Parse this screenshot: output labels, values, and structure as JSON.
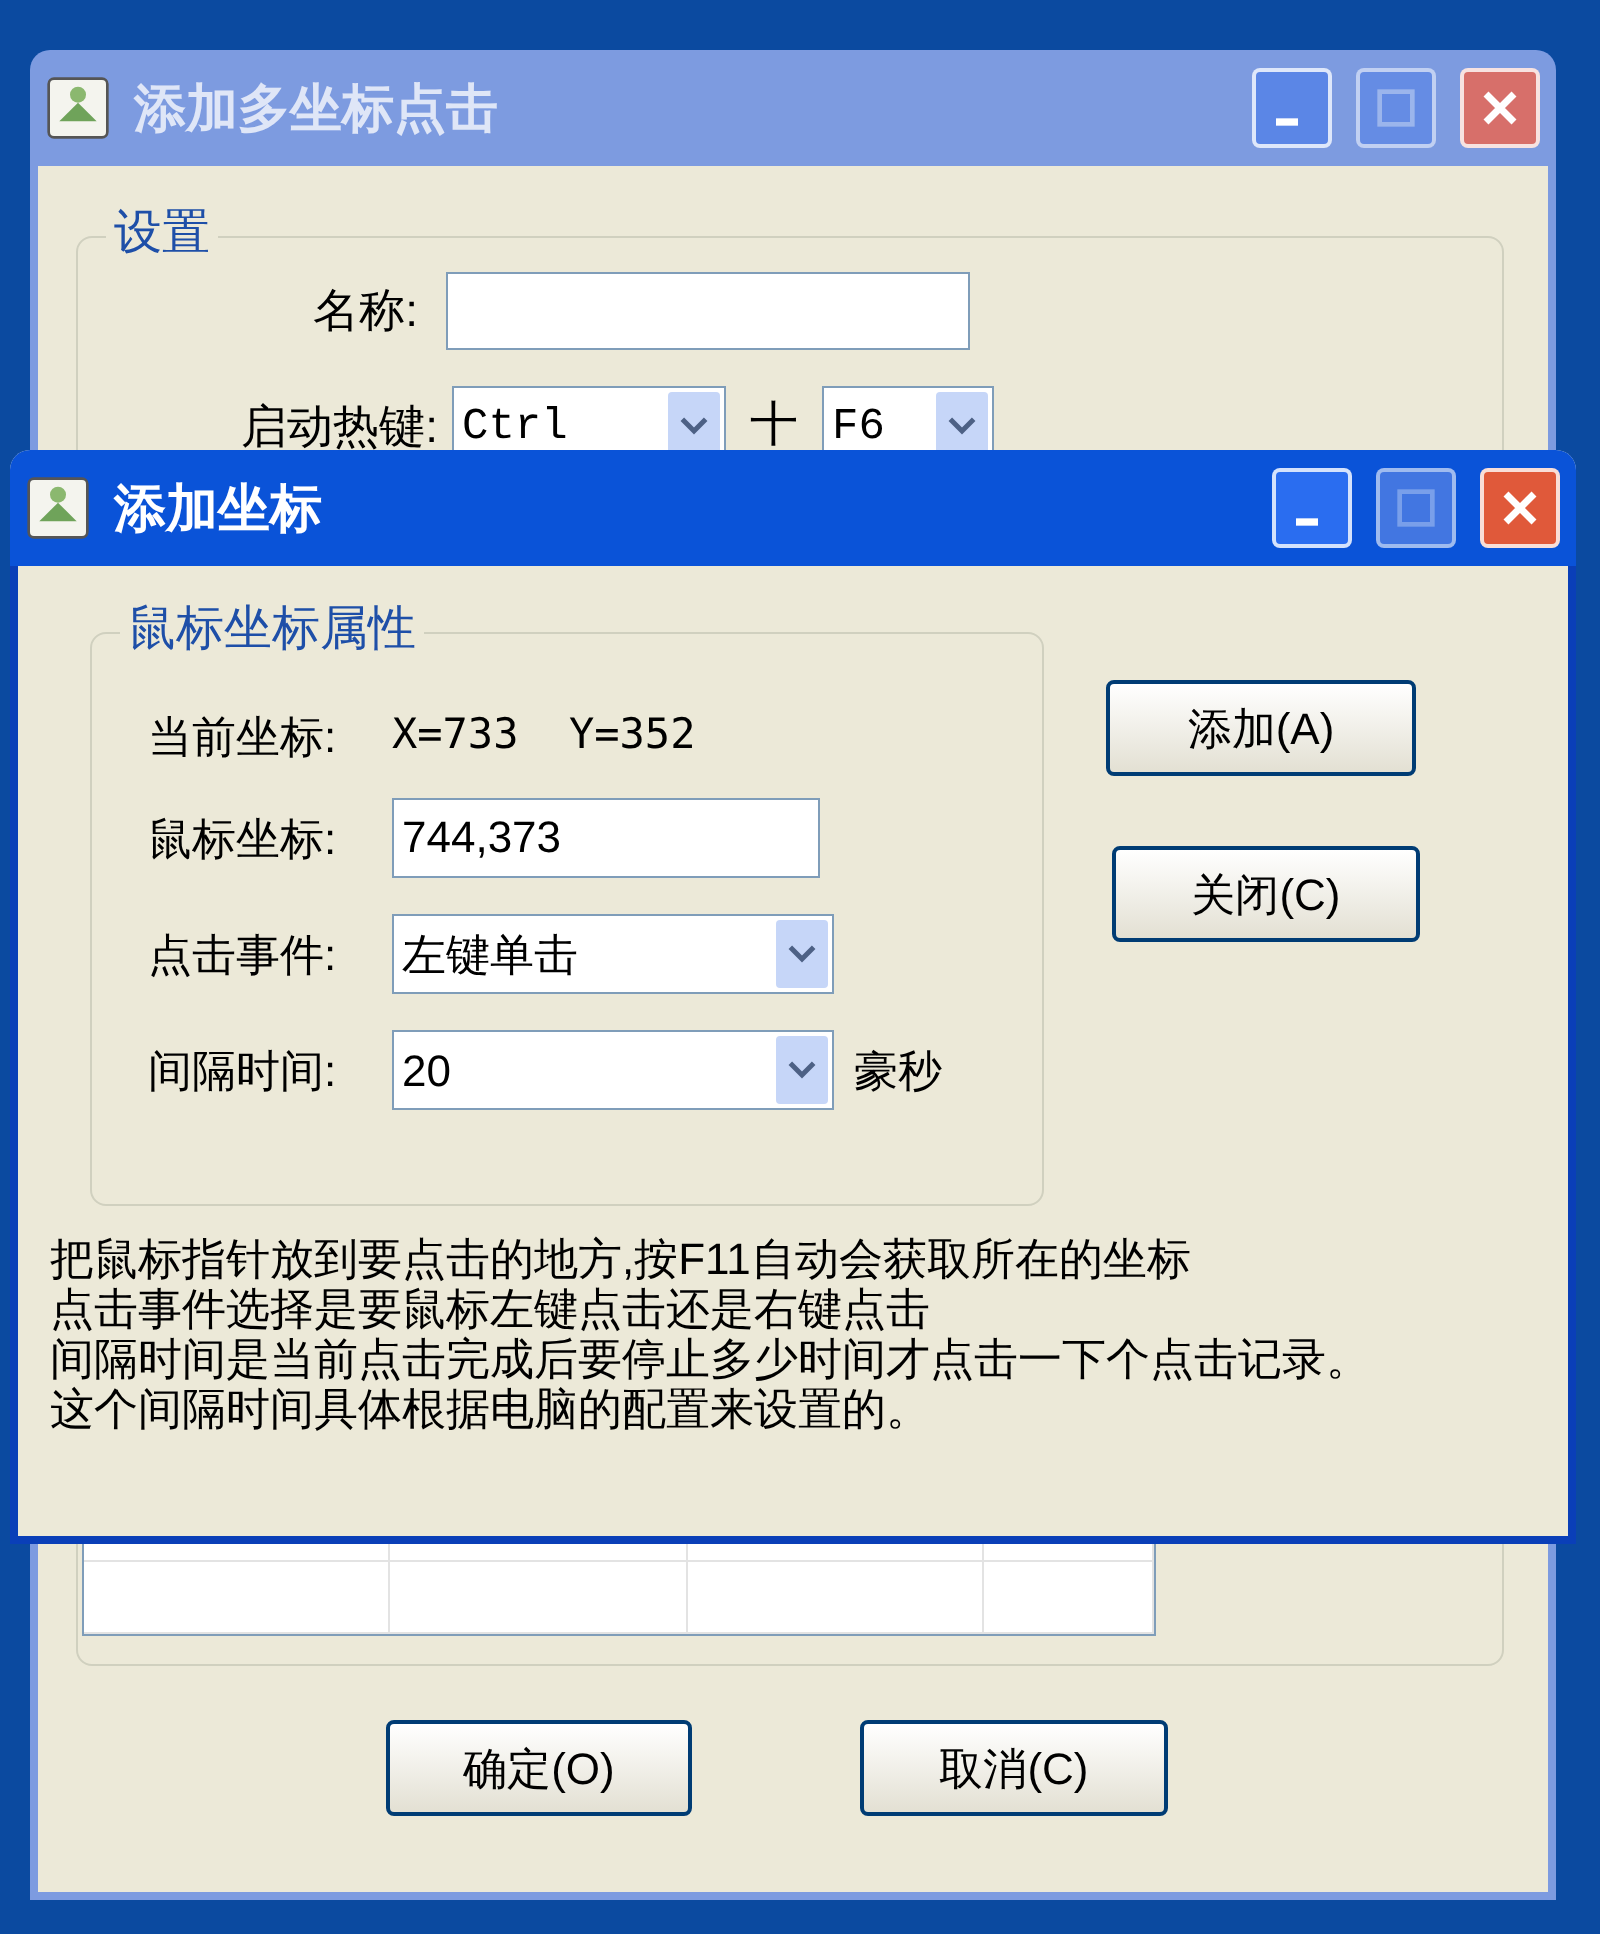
{
  "outer_window": {
    "title": "添加多坐标点击",
    "active": false,
    "settings": {
      "title": "设置",
      "name_label": "名称:",
      "hotkey_label": "启动热键:",
      "modifier": "Ctrl",
      "plus": "十",
      "key": "F6"
    },
    "buttons": [
      {
        "label": "确定(O)"
      },
      {
        "label": "取消(C)"
      }
    ]
  },
  "inner_window": {
    "title": "添加坐标",
    "active": true,
    "group": {
      "title": "鼠标坐标属性",
      "rows": [
        {
          "kind": "text",
          "label": "当前坐标:",
          "value": "X=733  Y=352"
        },
        {
          "kind": "input",
          "label": "鼠标坐标:",
          "value": "744,373"
        },
        {
          "kind": "select",
          "label": "点击事件:",
          "value": "左键单击"
        },
        {
          "kind": "select",
          "label": "间隔时间:",
          "value": "20",
          "unit": "豪秒"
        }
      ]
    },
    "buttons": [
      {
        "label": "添加(A)"
      },
      {
        "label": "关闭(C)"
      }
    ],
    "help_lines": [
      "把鼠标指针放到要点击的地方,按F11自动会获取所在的坐标",
      "点击事件选择是要鼠标左键点击还是右键点击",
      "间隔时间是当前点击完成后要停止多少时间才点击一下个点击记录。",
      "这个间隔时间具体根据电脑的配置来设置的。"
    ]
  }
}
